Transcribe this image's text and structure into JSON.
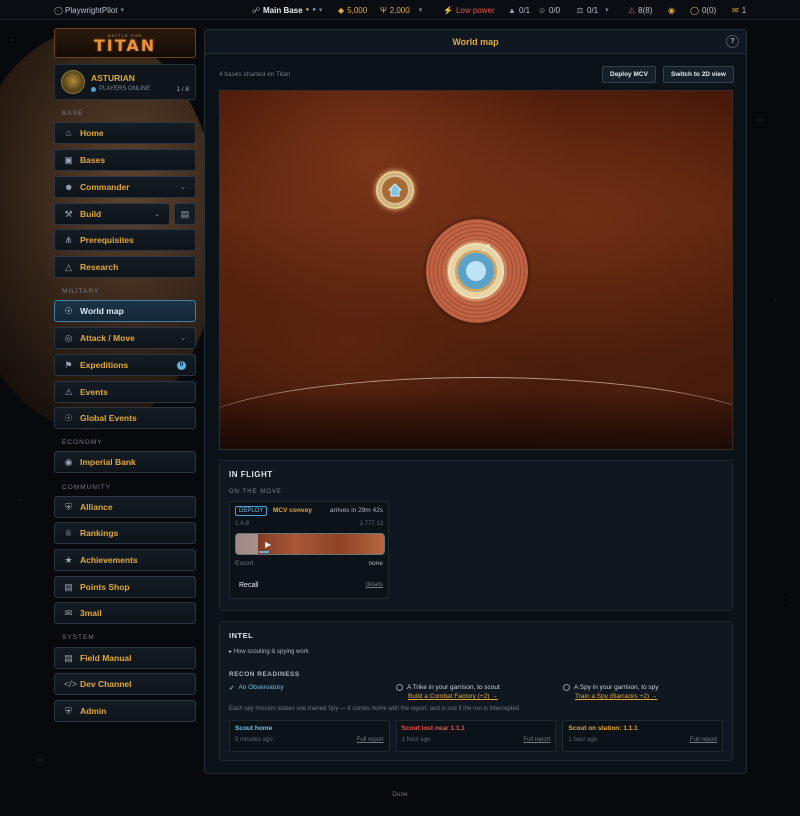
{
  "topbar": {
    "user": "PlaywrightPilot",
    "base": "Main Base",
    "resource1": "5,000",
    "resource2": "2,000",
    "power": "Low power",
    "stat1": "0/1",
    "stat2": "0/0",
    "stat3": "0/1",
    "alerts": "8(8)",
    "shield": "0(0)",
    "mail": "1"
  },
  "logo": {
    "small": "BATTLE FOR",
    "big": "TITAN"
  },
  "profile": {
    "name": "ASTURIAN",
    "status": "PLAYERS ONLINE",
    "count": "1 / 8"
  },
  "sections": {
    "base": "BASE",
    "military": "MILITARY",
    "economy": "ECONOMY",
    "community": "COMMUNITY",
    "system": "SYSTEM"
  },
  "nav": {
    "home": "Home",
    "bases": "Bases",
    "commander": "Commander",
    "build": "Build",
    "prerequisites": "Prerequisites",
    "research": "Research",
    "world_map": "World map",
    "attack_move": "Attack / Move",
    "expeditions": "Expeditions",
    "expeditions_badge": "0",
    "events": "Events",
    "global_events": "Global Events",
    "imperial_bank": "Imperial Bank",
    "alliance": "Alliance",
    "rankings": "Rankings",
    "achievements": "Achievements",
    "points_shop": "Points Shop",
    "mail": "3mail",
    "field_manual": "Field Manual",
    "dev_channel": "Dev Channel",
    "admin": "Admin"
  },
  "panel": {
    "title": "World map",
    "help": "?",
    "subtitle": "4 bases charted on Titan",
    "deploy_button": "Deploy MCV",
    "switch_button": "Switch to 2D view"
  },
  "in_flight": {
    "title": "IN FLIGHT",
    "sub": "ON THE MOVE",
    "tag": "DEPLOY",
    "name": "MCV convoy",
    "arrives": "arrives in 29m 42s",
    "from": "1.A.8",
    "to": "1.777.13",
    "escort_label": "Escort",
    "escort_value": "none",
    "recall": "Recall",
    "details": "details",
    "progress": 0.15
  },
  "intel": {
    "title": "INTEL",
    "howto": "How scouting & spying work",
    "recon": "RECON READINESS",
    "req1": "An Observatory",
    "req2": "A Trike in your garrison, to scout",
    "req2_link": "Build a Combat Factory (+2) →",
    "req3": "A Spy in your garrison, to spy",
    "req3_link": "Train a Spy (Barracks +2) →",
    "note": "Each spy mission stakes one trained Spy — it comes home with the report, and is lost if the run is intercepted",
    "reports": [
      {
        "title": "Scout home",
        "time": "5 minutes ago",
        "link": "Full report"
      },
      {
        "title": "Scout lost near 1.1.1",
        "time": "1 hour ago",
        "link": "Full report"
      },
      {
        "title": "Scout on station: 1.1.1",
        "time": "1 hour ago",
        "link": "Full report"
      }
    ]
  },
  "footer": "Dune"
}
